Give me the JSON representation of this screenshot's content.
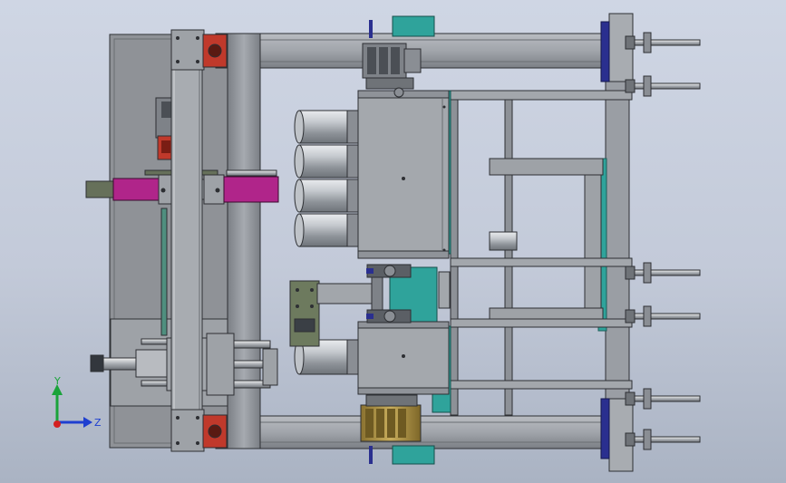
{
  "viewport": {
    "background_top": "#cfd6e4",
    "background_bottom": "#aab3c3"
  },
  "model": {
    "frame_color": "#9a9da3",
    "frame_dark": "#5b5e63",
    "steel_color": "#8f959c",
    "teal_color": "#2fa39b",
    "magenta_color": "#b0258a",
    "red_color": "#c0392b",
    "navy_color": "#2a2f8f",
    "gearbox_color": "#b69a46",
    "cylinder_color": "#a7abb0"
  },
  "triad": {
    "y_label": "Y",
    "z_label": "Z",
    "y_color": "#1aa33a",
    "z_color": "#1e3fd0",
    "x_color": "#d42020"
  }
}
